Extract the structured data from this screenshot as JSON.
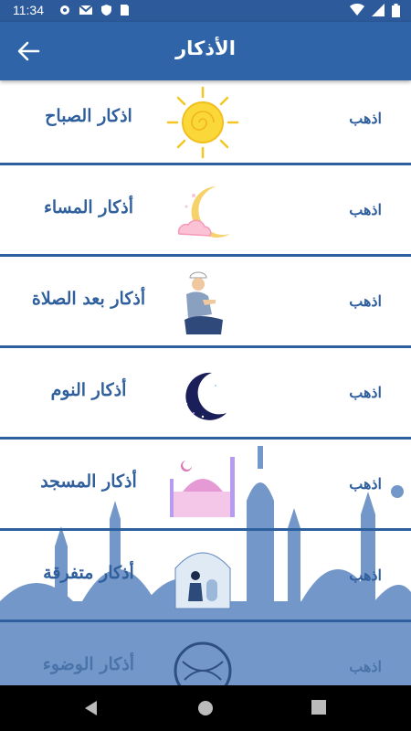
{
  "status_bar": {
    "time": "11:34"
  },
  "app_bar": {
    "title": "الأذكار"
  },
  "items": [
    {
      "label": "اذكار الصباح",
      "go": "اذهب",
      "icon": "sun-icon"
    },
    {
      "label": "أذكار المساء",
      "go": "اذهب",
      "icon": "moon-clouds-icon"
    },
    {
      "label": "أذكار بعد الصلاة",
      "go": "اذهب",
      "icon": "praying-man-icon"
    },
    {
      "label": "أذكار النوم",
      "go": "اذهب",
      "icon": "crescent-moon-icon"
    },
    {
      "label": "أذكار المسجد",
      "go": "اذهب",
      "icon": "mosque-icon"
    },
    {
      "label": "أذكار متفرقة",
      "go": "اذهب",
      "icon": "man-at-mosque-icon"
    },
    {
      "label": "أذكار الوضوء",
      "go": "اذهب",
      "icon": "wudu-icon"
    }
  ],
  "colors": {
    "app_bar": "#2f64a8",
    "status_bar": "#2c5a9a",
    "text": "#2f5f9c",
    "divider": "#2e5f9f",
    "skyline": "#5c86c0"
  }
}
